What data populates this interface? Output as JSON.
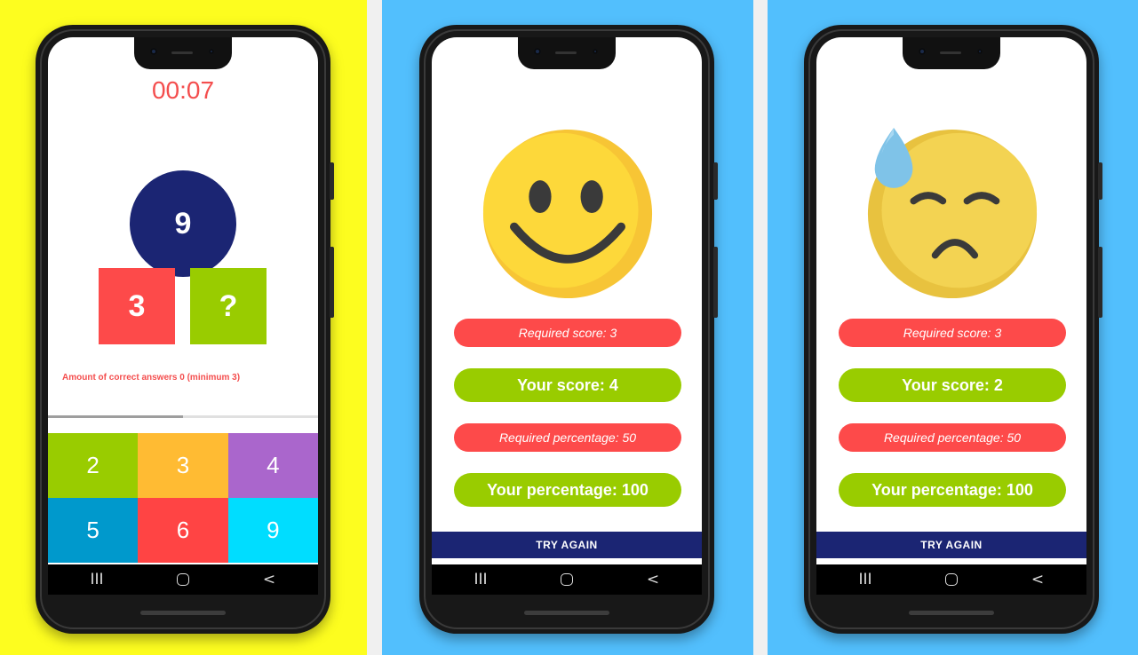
{
  "game": {
    "timer": "00:07",
    "target_number": "9",
    "left_operand": "3",
    "right_operand": "?",
    "hint": "Amount of correct answers 0 (minimum 3)",
    "progress": 0.5,
    "answers": [
      {
        "label": "2",
        "color": "#99cc00"
      },
      {
        "label": "3",
        "color": "#ffbb33"
      },
      {
        "label": "4",
        "color": "#aa66cc"
      },
      {
        "label": "5",
        "color": "#0099cc"
      },
      {
        "label": "6",
        "color": "#ff4444"
      },
      {
        "label": "9",
        "color": "#00ddff"
      }
    ]
  },
  "result_success": {
    "face": "smiling-face-icon",
    "required_score": "Required score: 3",
    "your_score": "Your score: 4",
    "required_percentage": "Required percentage: 50",
    "your_percentage": "Your percentage: 100",
    "try_again": "TRY AGAIN"
  },
  "result_fail": {
    "face": "sad-sweat-face-icon",
    "required_score": "Required score: 3",
    "your_score": "Your score: 2",
    "required_percentage": "Required percentage: 50",
    "your_percentage": "Your percentage: 100",
    "try_again": "TRY AGAIN"
  },
  "nav": {
    "recents": "III",
    "home": "",
    "back": "<"
  },
  "colors": {
    "yellow_bg": "#fdfd1f",
    "blue_bg": "#52bffd",
    "navy": "#1b2573",
    "red": "#fd4a4a",
    "green": "#99cc00"
  }
}
